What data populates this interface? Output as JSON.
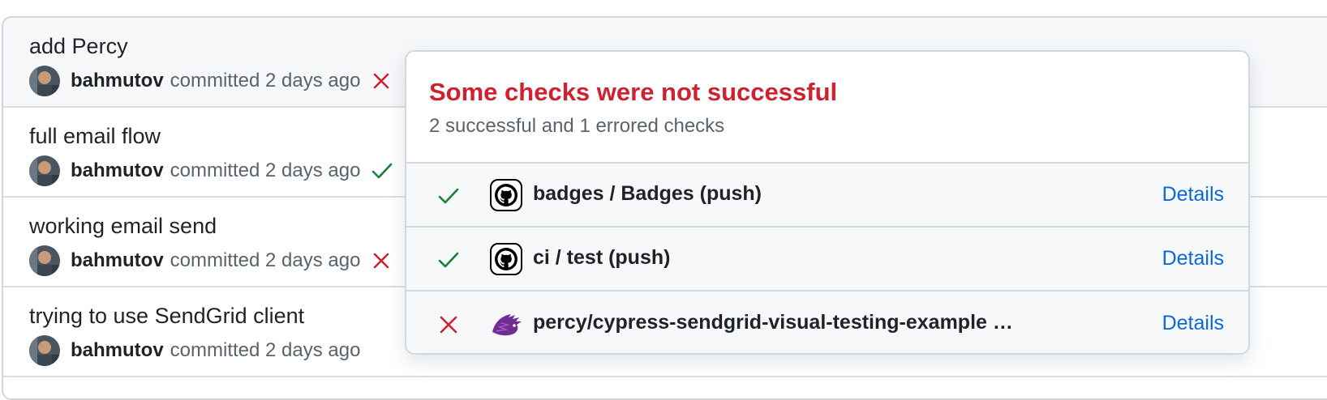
{
  "commits": [
    {
      "title": "add Percy",
      "author": "bahmutov",
      "meta": "committed 2 days ago",
      "status": "failure",
      "status_icon": "x-icon"
    },
    {
      "title": "full email flow",
      "author": "bahmutov",
      "meta": "committed 2 days ago",
      "status": "success",
      "status_icon": "check-icon"
    },
    {
      "title": "working email send",
      "author": "bahmutov",
      "meta": "committed 2 days ago",
      "status": "failure",
      "status_icon": "x-icon"
    },
    {
      "title": "trying to use SendGrid client",
      "author": "bahmutov",
      "meta": "committed 2 days ago",
      "status": "none",
      "status_icon": ""
    }
  ],
  "popover": {
    "title": "Some checks were not successful",
    "subtitle": "2 successful and 1 errored checks",
    "checks": [
      {
        "status": "success",
        "app_icon": "github-icon",
        "name": "badges / Badges (push)",
        "details_label": "Details"
      },
      {
        "status": "success",
        "app_icon": "github-icon",
        "name": "ci / test (push)",
        "details_label": "Details"
      },
      {
        "status": "failure",
        "app_icon": "percy-icon",
        "name": "percy/cypress-sendgrid-visual-testing-example …",
        "details_label": "Details"
      }
    ]
  },
  "colors": {
    "error": "#cf222e",
    "success": "#1a7f37",
    "link": "#0969da",
    "muted": "#59636e",
    "percy": "#6f2c91"
  }
}
